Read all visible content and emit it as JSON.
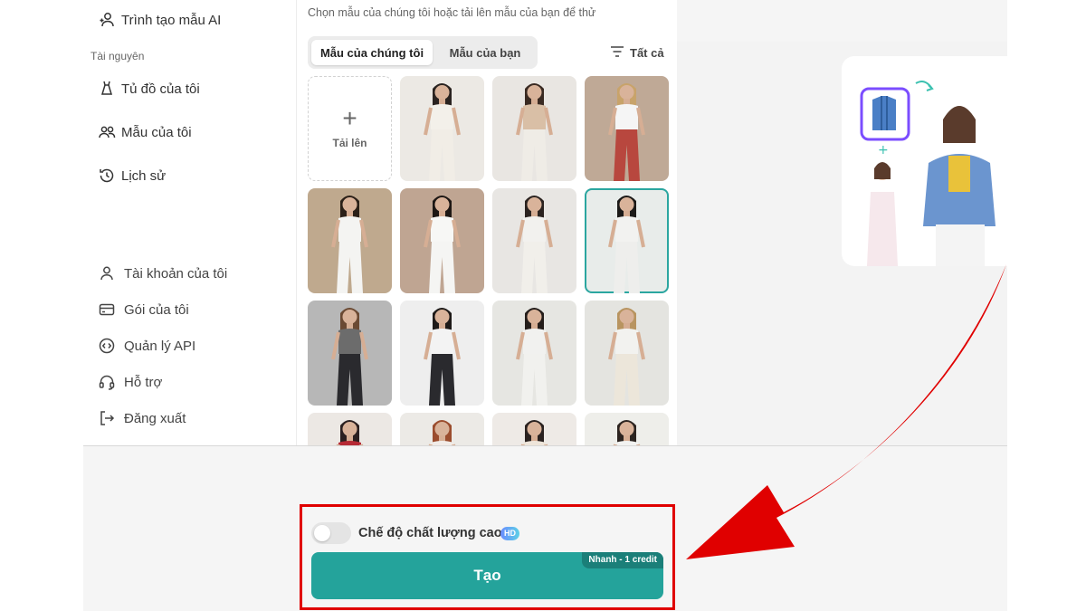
{
  "sidebar": {
    "top_item": "Trình tạo mẫu AI",
    "section_title": "Tài nguyên",
    "resources": [
      {
        "label": "Tủ đồ của tôi"
      },
      {
        "label": "Mẫu của tôi"
      },
      {
        "label": "Lịch sử"
      }
    ],
    "account": [
      {
        "label": "Tài khoản của tôi"
      },
      {
        "label": "Gói của tôi"
      },
      {
        "label": "Quản lý API"
      },
      {
        "label": "Hỗ trợ"
      },
      {
        "label": "Đăng xuất"
      }
    ]
  },
  "main": {
    "hint": "Chọn mẫu của chúng tôi hoặc tải lên mẫu của bạn để thử",
    "tabs": [
      {
        "label": "Mẫu của chúng tôi",
        "active": true
      },
      {
        "label": "Mẫu của bạn",
        "active": false
      }
    ],
    "filter_label": "Tất cả",
    "upload_label": "Tải lên"
  },
  "bottom": {
    "quality_label": "Chế độ chất lượng cao",
    "hd_badge": "HD",
    "create_label": "Tạo",
    "credit_tag": "Nhanh - 1 credit",
    "quality_toggle_on": false
  },
  "colors": {
    "accent": "#24a39b",
    "accent_dark": "#1b7f79",
    "highlight": "#e00000"
  }
}
